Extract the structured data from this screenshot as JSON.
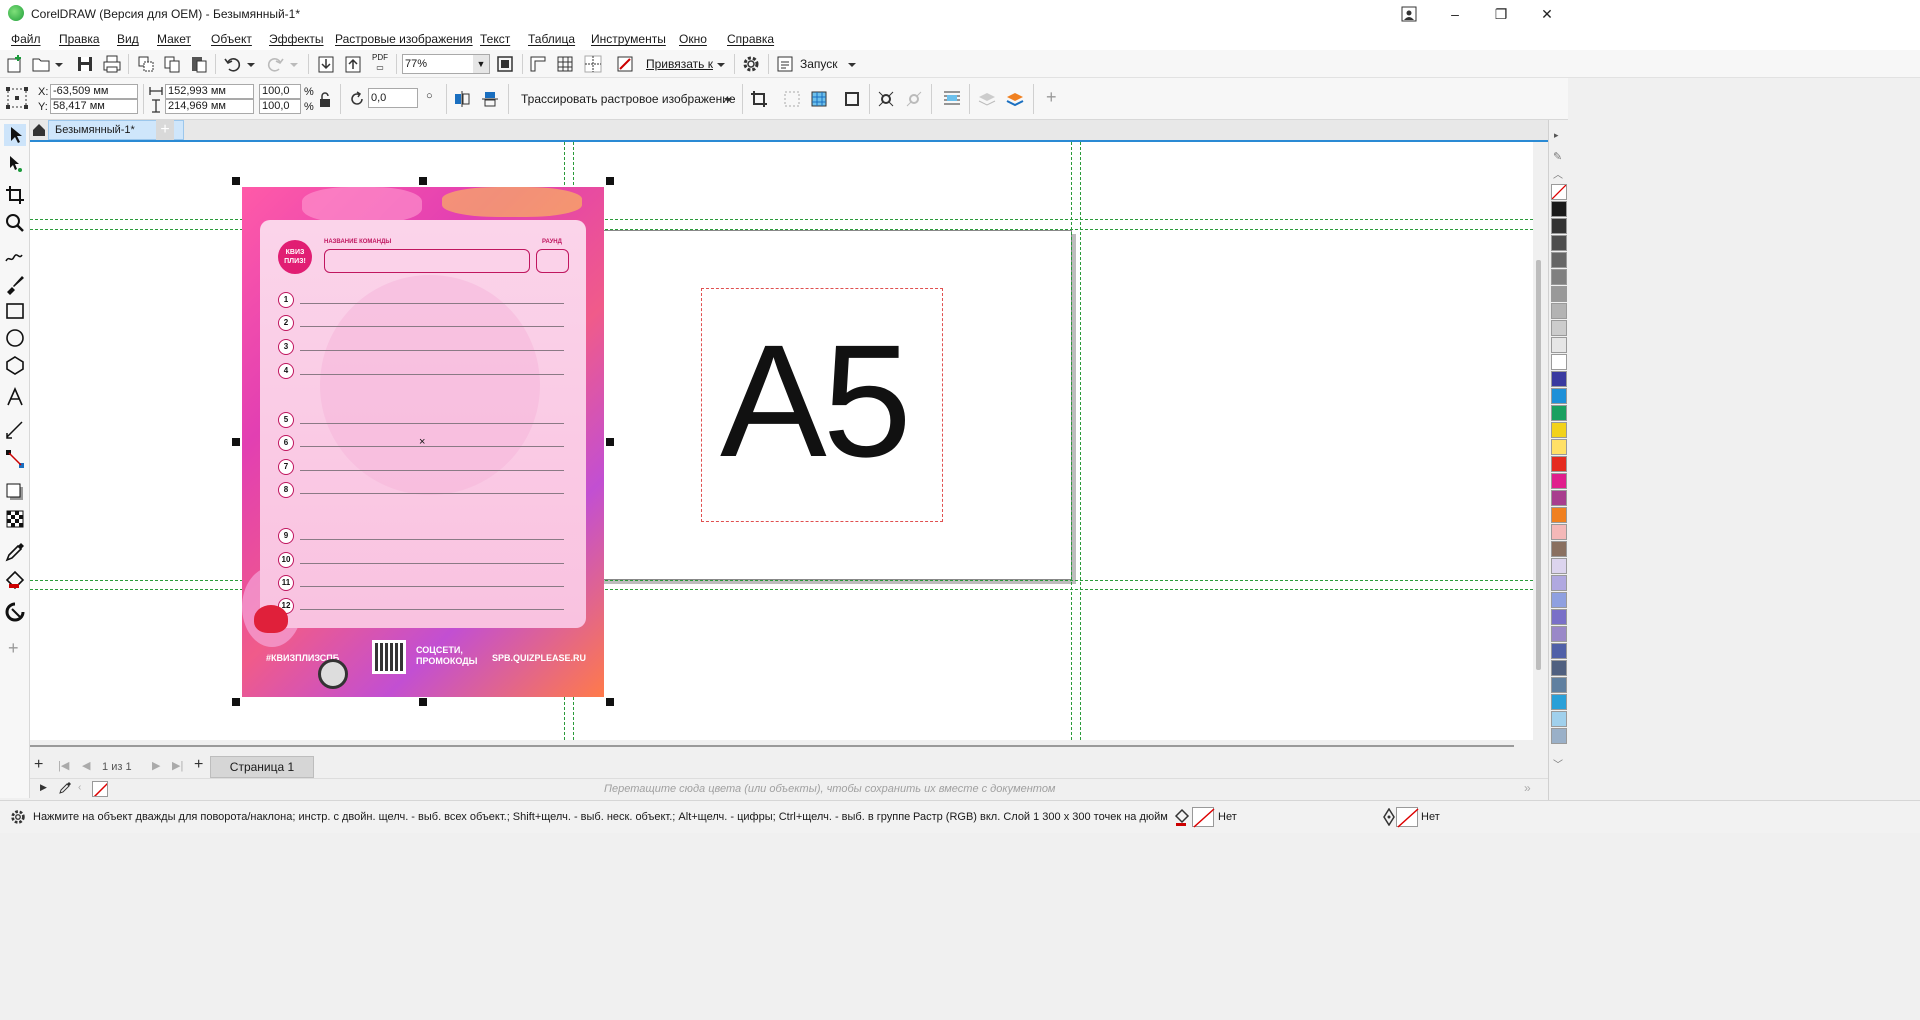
{
  "window": {
    "title": "CorelDRAW (Версия для OEM) - Безымянный-1*",
    "buttons": {
      "minimize": "–",
      "maximize": "❐",
      "close": "✕"
    }
  },
  "menu": [
    "Файл",
    "Правка",
    "Вид",
    "Макет",
    "Объект",
    "Эффекты",
    "Растровые изображения",
    "Текст",
    "Таблица",
    "Инструменты",
    "Окно",
    "Справка"
  ],
  "standard_toolbar": {
    "zoom": "77%",
    "snap_label": "Привязать к",
    "launch_label": "Запуск",
    "pdf_label": "PDF"
  },
  "property_bar": {
    "x_label": "X:",
    "x_value": "-63,509 мм",
    "y_label": "Y:",
    "y_value": "58,417 мм",
    "width_value": "152,993 мм",
    "height_value": "214,969 мм",
    "scale_x": "100,0",
    "scale_y": "100,0",
    "percent": "%",
    "rotation": "0,0",
    "degree_symbol": "○",
    "trace_label": "Трассировать растровое изображение"
  },
  "document_tab": {
    "label": "Безымянный-1*"
  },
  "canvas": {
    "a5_label": "A5",
    "card": {
      "team_label": "НАЗВАНИЕ КОМАНДЫ",
      "round_label": "РАУНД",
      "logo_text": "КВИЗ ПЛИЗ!",
      "numbers": [
        "1",
        "2",
        "3",
        "4",
        "5",
        "6",
        "7",
        "8",
        "9",
        "10",
        "11",
        "12"
      ],
      "hashtag": "#КВИЗПЛИЗСПБ",
      "social_line1": "СОЦСЕТИ,",
      "social_line2": "ПРОМОКОДЫ",
      "website": "SPB.QUIZPLEASE.RU"
    }
  },
  "page_navigation": {
    "current": "1",
    "of_label": "из",
    "total": "1",
    "page_tab": "Страница 1"
  },
  "document_palette_hint": "Перетащите сюда цвета (или объекты), чтобы сохранить их вместе с документом",
  "status": {
    "hint": "Нажмите на объект дважды для поворота/наклона; инстр. с двойн. щелч. - выб. всех объект.; Shift+щелч. - выб. неск. объект.; Alt+щелч. - цифры; Ctrl+щелч. - выб. в группе",
    "object_info": "Растр (RGB) вкл. Слой 1  300 x 300 точек на дюйм",
    "fill_label": "Нет",
    "outline_label": "Нет"
  },
  "palette_colors": [
    "#ffffff",
    "#1a1a1a",
    "#333333",
    "#4d4d4d",
    "#666666",
    "#808080",
    "#999999",
    "#b3b3b3",
    "#cccccc",
    "#e6e6e6",
    "#ffffff",
    "#3a3aa0",
    "#1e90d8",
    "#1aa060",
    "#f2d21a",
    "#ffe066",
    "#e52a1f",
    "#e01e8c",
    "#a83d8e",
    "#f08020",
    "#f4b8b8",
    "#8a7060",
    "#dcd4ee",
    "#b0a8e0",
    "#8fa0e0",
    "#7a70c8",
    "#9a88c8",
    "#5060a8",
    "#506080",
    "#6080a0",
    "#2aa0d8",
    "#a0d0ec",
    "#9ab0c8"
  ]
}
